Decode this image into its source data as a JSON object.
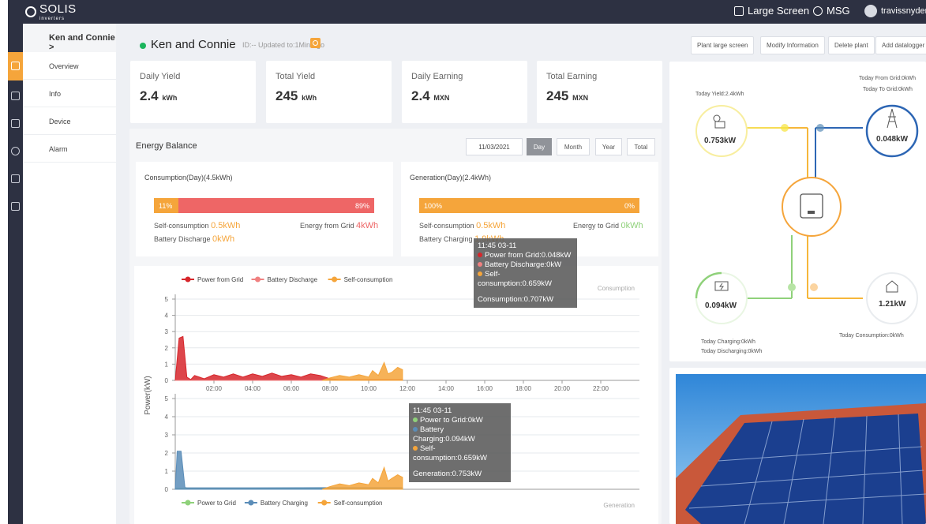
{
  "topbar": {
    "brand": "SOLIS",
    "brand_sub": "inverters",
    "large_screen": "Large Screen",
    "msg": "MSG",
    "username": "travissnyder"
  },
  "menu": {
    "plant_name": "Ken and Connie >",
    "items": [
      {
        "label": "Overview"
      },
      {
        "label": "Info"
      },
      {
        "label": "Device"
      },
      {
        "label": "Alarm"
      }
    ]
  },
  "header": {
    "title": "Ken and Connie",
    "id_text": "ID:--  Updated to:1Min Ago",
    "buttons": [
      "Plant large screen",
      "Modify Information",
      "Delete plant",
      "Add datalogger"
    ]
  },
  "stats": [
    {
      "label": "Daily Yield",
      "value": "2.4",
      "unit": "kWh"
    },
    {
      "label": "Total Yield",
      "value": "245",
      "unit": "kWh"
    },
    {
      "label": "Daily Earning",
      "value": "2.4",
      "unit": "MXN"
    },
    {
      "label": "Total Earning",
      "value": "245",
      "unit": "MXN"
    }
  ],
  "energy_balance": {
    "title": "Energy Balance",
    "date": "11/03/2021",
    "ranges": [
      "Day",
      "Month",
      "Year",
      "Total"
    ],
    "active_range": "Day",
    "consumption": {
      "title": "Consumption(Day)(4.5kWh)",
      "self_pct": "11%",
      "grid_pct": "89%",
      "self_label": "Self-consumption",
      "self_value": "0.5kWh",
      "grid_label": "Energy from Grid",
      "grid_value": "4kWh",
      "battery_label": "Battery Discharge",
      "battery_value": "0kWh"
    },
    "generation": {
      "title": "Generation(Day)(2.4kWh)",
      "self_pct": "100%",
      "grid_pct": "0%",
      "self_label": "Self-consumption",
      "self_value": "0.5kWh",
      "grid_label": "Energy to Grid",
      "grid_value": "0kWh",
      "battery_label": "Battery Charging",
      "battery_value": "1.9kWh"
    }
  },
  "tooltips": {
    "consumption": {
      "time": "11:45 03-11",
      "lines": [
        "Power from Grid:0.048kW",
        "Battery Discharge:0kW",
        "Self-consumption:0.659kW"
      ],
      "total": "Consumption:0.707kW"
    },
    "generation": {
      "time": "11:45 03-11",
      "lines": [
        "Power to Grid:0kW",
        "Battery Charging:0.094kW",
        "Self-consumption:0.659kW"
      ],
      "total": "Generation:0.753kW"
    }
  },
  "chart_data": [
    {
      "type": "area",
      "title": "Consumption",
      "ylabel": "Power(kW)",
      "xticks": [
        "02:00",
        "04:00",
        "06:00",
        "08:00",
        "10:00",
        "12:00",
        "14:00",
        "16:00",
        "18:00",
        "20:00",
        "22:00"
      ],
      "yticks": [
        0,
        1,
        2,
        3,
        4,
        5
      ],
      "ylim": [
        0,
        5
      ],
      "xlim_hours": [
        0,
        24
      ],
      "series": [
        {
          "name": "Power from Grid",
          "color": "#d7262b",
          "x": [
            0,
            0.2,
            0.4,
            0.6,
            0.8,
            1.0,
            1.5,
            2,
            2.5,
            3,
            3.5,
            4,
            4.5,
            5,
            5.5,
            6,
            6.5,
            7,
            7.5,
            8,
            8.5,
            9,
            9.5,
            10,
            10.5,
            11,
            11.75
          ],
          "y": [
            0,
            2.6,
            2.7,
            0.2,
            0.05,
            0.3,
            0.1,
            0.35,
            0.2,
            0.4,
            0.2,
            0.4,
            0.25,
            0.45,
            0.25,
            0.35,
            0.2,
            0.4,
            0.3,
            0.1,
            0.05,
            0.05,
            0.05,
            0.05,
            0.05,
            0.05,
            0.048
          ]
        },
        {
          "name": "Battery Discharge",
          "color": "#f08080",
          "x": [
            0,
            11.75
          ],
          "y": [
            0,
            0
          ]
        },
        {
          "name": "Self-consumption",
          "color": "#f5a53b",
          "x": [
            7.6,
            8,
            8.5,
            9,
            9.5,
            10,
            10.2,
            10.5,
            10.8,
            11,
            11.2,
            11.5,
            11.75
          ],
          "y": [
            0,
            0.15,
            0.3,
            0.2,
            0.35,
            0.2,
            0.6,
            0.3,
            1.1,
            0.4,
            0.5,
            0.8,
            0.659
          ]
        }
      ],
      "grid": true,
      "legend": "top-left"
    },
    {
      "type": "area",
      "title": "Generation",
      "ylabel": "Power(kW)",
      "yticks": [
        0,
        1,
        2,
        3,
        4,
        5
      ],
      "ylim": [
        0,
        5
      ],
      "xlim_hours": [
        0,
        24
      ],
      "series": [
        {
          "name": "Power to Grid",
          "color": "#8fd17a",
          "x": [
            0,
            11.75
          ],
          "y": [
            0.05,
            0.05
          ]
        },
        {
          "name": "Battery Charging",
          "color": "#5b8db8",
          "x": [
            0,
            0.1,
            0.3,
            0.5,
            0.6,
            1,
            4,
            8,
            11.75
          ],
          "y": [
            0,
            2.1,
            2.1,
            0.1,
            0.08,
            0.08,
            0.08,
            0.09,
            0.094
          ]
        },
        {
          "name": "Self-consumption",
          "color": "#f5a53b",
          "x": [
            7.6,
            8,
            8.5,
            9,
            9.5,
            10,
            10.2,
            10.5,
            10.8,
            11,
            11.2,
            11.5,
            11.75
          ],
          "y": [
            0,
            0.15,
            0.3,
            0.2,
            0.35,
            0.25,
            0.6,
            0.35,
            1.2,
            0.45,
            0.6,
            0.8,
            0.659
          ]
        }
      ],
      "grid": true,
      "legend": "bottom-left"
    }
  ],
  "flow": {
    "today_yield": "Today Yield:2.4kWh",
    "pv_power": "0.753kW",
    "grid_power": "0.048kW",
    "battery_power": "0.094kW",
    "load_power": "1.21kW",
    "today_from_grid": "Today From Grid:0kWh",
    "today_to_grid": "Today To Grid:0kWh",
    "today_charging": "Today Charging:0kWh",
    "today_discharging": "Today Discharging:0kWh",
    "today_consumption": "Today Consumption:0kWh"
  }
}
